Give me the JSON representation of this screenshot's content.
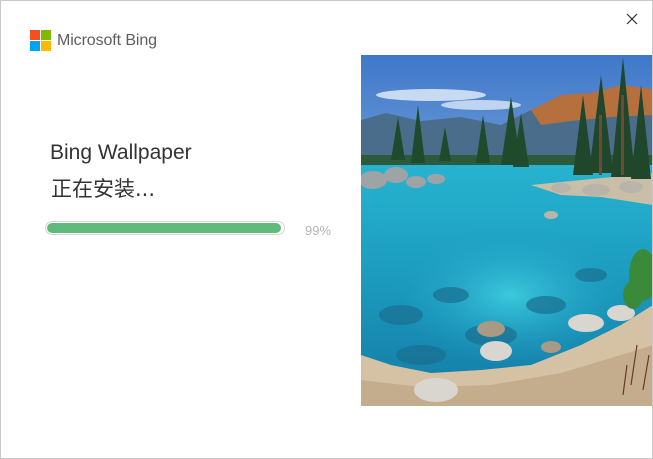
{
  "window": {
    "close_icon": "close-icon"
  },
  "brand": {
    "logo_colors": [
      "#f25022",
      "#7fba00",
      "#00a4ef",
      "#ffb900"
    ],
    "name": "Microsoft Bing"
  },
  "installer": {
    "product_name": "Bing Wallpaper",
    "status": "正在安装...",
    "progress_fraction": 0.99,
    "progress_label": "99%",
    "progress_color": "#5fba7d"
  },
  "hero_image": {
    "subject": "lake shoreline with turquoise water, boulders and pine trees"
  }
}
